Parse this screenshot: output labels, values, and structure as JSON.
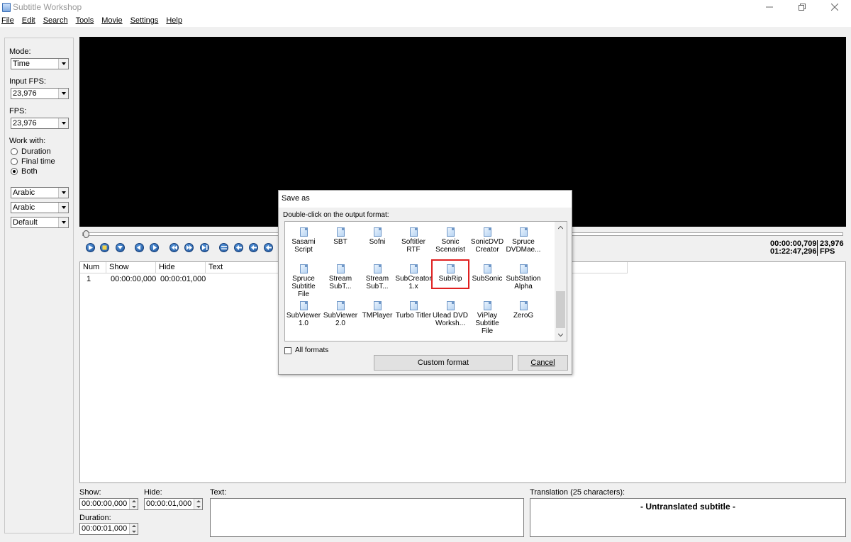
{
  "window": {
    "title": "Subtitle Workshop"
  },
  "menu": [
    "File",
    "Edit",
    "Search",
    "Tools",
    "Movie",
    "Settings",
    "Help"
  ],
  "left_panel": {
    "mode_label": "Mode:",
    "mode_value": "Time",
    "input_fps_label": "Input FPS:",
    "input_fps_value": "23,976",
    "fps_label": "FPS:",
    "fps_value": "23,976",
    "work_with_label": "Work with:",
    "work_options": [
      "Duration",
      "Final time",
      "Both"
    ],
    "work_selected": "Both",
    "combo1": "Arabic",
    "combo2": "Arabic",
    "combo3": "Default"
  },
  "player": {
    "time_current": "00:00:00,709",
    "time_total": "01:22:47,296",
    "fps_value": "23,976",
    "fps_unit": "FPS"
  },
  "list": {
    "columns": [
      "Num",
      "Show",
      "Hide",
      "Text"
    ],
    "rows": [
      {
        "num": "1",
        "show": "00:00:00,000",
        "hide": "00:00:01,000",
        "text": ""
      }
    ]
  },
  "editor": {
    "show_label": "Show:",
    "show_value": "00:00:00,000",
    "hide_label": "Hide:",
    "hide_value": "00:00:01,000",
    "duration_label": "Duration:",
    "duration_value": "00:00:01,000",
    "text_label": "Text:",
    "translation_label": "Translation (25 characters):",
    "translation_value": "- Untranslated subtitle -"
  },
  "dialog": {
    "title": "Save as",
    "caption": "Double-click on the output format:",
    "formats": [
      [
        "Sasami",
        "Script"
      ],
      [
        "SBT"
      ],
      [
        "Sofni"
      ],
      [
        "Softitler",
        "RTF"
      ],
      [
        "Sonic",
        "Scenarist"
      ],
      [
        "SonicDVD",
        "Creator"
      ],
      [
        "Spruce",
        "DVDMae..."
      ],
      [
        "Spruce",
        "Subtitle File"
      ],
      [
        "Stream",
        "SubT..."
      ],
      [
        "Stream",
        "SubT..."
      ],
      [
        "SubCreator",
        "1.x"
      ],
      [
        "SubRip"
      ],
      [
        "SubSonic"
      ],
      [
        "SubStation",
        "Alpha"
      ],
      [
        "SubViewer",
        "1.0"
      ],
      [
        "SubViewer",
        "2.0"
      ],
      [
        "TMPlayer"
      ],
      [
        "Turbo Titler"
      ],
      [
        "Ulead DVD",
        "Worksh..."
      ],
      [
        "ViPlay",
        "Subtitle File"
      ],
      [
        "ZeroG"
      ]
    ],
    "highlighted": "SubRip",
    "all_formats_label": "All formats",
    "custom_button": "Custom format",
    "cancel_button": "Cancel"
  }
}
